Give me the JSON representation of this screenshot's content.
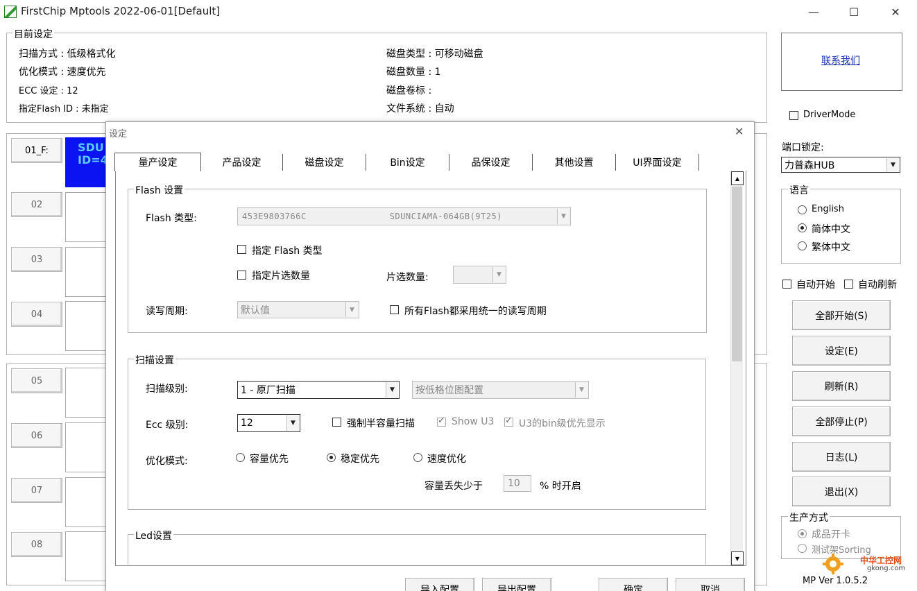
{
  "window": {
    "title": "FirstChip Mptools   2022-06-01[Default]",
    "minimize": "—",
    "maximize": "☐",
    "close": "✕"
  },
  "current_settings": {
    "legend": "目前设定",
    "scan_mode": "扫描方式 : 低级格式化",
    "opt_mode": "优化模式 : 速度优先",
    "ecc": "ECC 设定 : 12",
    "flash_id": "指定Flash ID : 未指定",
    "disk_type": "磁盘类型 : 可移动磁盘",
    "disk_count": "磁盘数量 : 1",
    "disk_label": "磁盘卷标 :",
    "filesystem": "文件系统 : 自动"
  },
  "slots": [
    {
      "label": "01_F:",
      "info": "SDU\nID=4"
    },
    {
      "label": "02"
    },
    {
      "label": "03"
    },
    {
      "label": "04"
    },
    {
      "label": "05"
    },
    {
      "label": "06"
    },
    {
      "label": "07"
    },
    {
      "label": "08"
    }
  ],
  "slot1_info_line1": "SDU",
  "slot1_info_line2": "ID=4",
  "right_panel": {
    "contact": "联系我们",
    "driver_mode": "DriverMode",
    "port_lock_label": "端口锁定:",
    "port_lock_value": "力普森HUB",
    "language_legend": "语言",
    "lang_en": "English",
    "lang_sc": "简体中文",
    "lang_tc": "繁体中文",
    "auto_start": "自动开始",
    "auto_refresh": "自动刷新",
    "btn_start_all": "全部开始(S)",
    "btn_settings": "设定(E)",
    "btn_refresh": "刷新(R)",
    "btn_stop_all": "全部停止(P)",
    "btn_log": "日志(L)",
    "btn_exit": "退出(X)",
    "production_legend": "生产方式",
    "prod_card": "成品开卡",
    "prod_rack": "测试架Sorting",
    "version": "MP Ver 1.0.5.2",
    "watermark_cn": "中华工控网",
    "watermark_url": "gkong.com"
  },
  "dialog": {
    "title": "设定",
    "close": "✕",
    "tabs": [
      "量产设定",
      "产品设定",
      "磁盘设定",
      "Bin设定",
      "品保设定",
      "其他设置",
      "UI界面设定"
    ],
    "flash_group": "Flash 设置",
    "flash_type_label": "Flash 类型:",
    "flash_type_id": "453E9803766C",
    "flash_type_model": "SDUNCIAMA-064GB(9T25)",
    "specify_flash_type": "指定 Flash 类型",
    "specify_chip_count": "指定片选数量",
    "chip_count_label": "片选数量:",
    "rw_cycle_label": "读写周期:",
    "rw_cycle_value": "默认值",
    "uniform_rw_cycle": "所有Flash都采用统一的读写周期",
    "scan_group": "扫描设置",
    "scan_level_label": "扫描级别:",
    "scan_level_value": "1 - 原厂扫描",
    "scan_bitmap_value": "按低格位图配置",
    "ecc_level_label": "Ecc 级别:",
    "ecc_level_value": "12",
    "force_half_scan": "强制半容量扫描",
    "show_u3": "Show U3",
    "u3_bin_priority": "U3的bin级优先显示",
    "opt_mode_label": "优化模式:",
    "opt_capacity": "容量优先",
    "opt_stable": "稳定优先",
    "opt_speed": "速度优化",
    "loss_label_pre": "容量丢失少于",
    "loss_value": "10",
    "loss_label_post": "% 时开启",
    "led_group": "Led设置",
    "btn_import": "导入配置",
    "btn_export": "导出配置",
    "btn_ok": "确定",
    "btn_cancel": "取消"
  }
}
